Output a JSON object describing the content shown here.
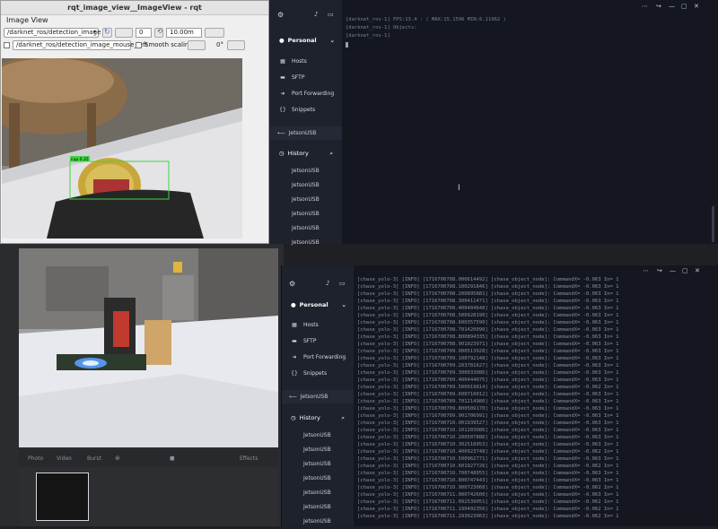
{
  "rqt": {
    "window_title": "rqt_image_view__ImageView - rqt",
    "dock_title": "Image View",
    "topic": "/darknet_ros/detection_image",
    "scale_value": "0",
    "fps_value": "10.00m",
    "mouse_topic": "/darknet_ros/detection_image_mouse_left",
    "smooth_scaling_label": "Smooth scaling",
    "rotation_value": "0°",
    "detection_label": "cup 0.35"
  },
  "term1": {
    "sidebar": {
      "personal_label": "Personal",
      "items": [
        {
          "icon": "hosts-icon",
          "label": "Hosts"
        },
        {
          "icon": "sftp-icon",
          "label": "SFTP"
        },
        {
          "icon": "port-forwarding-icon",
          "label": "Port Forwarding"
        },
        {
          "icon": "snippets-icon",
          "label": "Snippets"
        }
      ],
      "active_host": "JetsonUSB",
      "history_label": "History",
      "history": [
        "JetsonUSB",
        "JetsonUSB",
        "JetsonUSB",
        "JetsonUSB",
        "JetsonUSB",
        "JetsonUSB"
      ]
    },
    "lines": [
      "[darknet_ros-1] FPS:13.4 : ( MAX:15.1596 MIN:6.11962 )",
      "[darknet_ros-1] Objects:",
      "[darknet_ros-1]"
    ]
  },
  "camera": {
    "modes": [
      "Photo",
      "Video",
      "Burst"
    ],
    "effects_label": "Effects"
  },
  "term2": {
    "sidebar": {
      "personal_label": "Personal",
      "items": [
        {
          "icon": "hosts-icon",
          "label": "Hosts"
        },
        {
          "icon": "sftp-icon",
          "label": "SFTP"
        },
        {
          "icon": "port-forwarding-icon",
          "label": "Port Forwarding"
        },
        {
          "icon": "snippets-icon",
          "label": "Snippets"
        }
      ],
      "active_host": "JetsonUSB",
      "history_label": "History",
      "history": [
        "JetsonUSB",
        "JetsonUSB",
        "JetsonUSB",
        "JetsonUSB",
        "JetsonUSB",
        "JetsonUSB",
        "JetsonUSB",
        "JetsonUSB"
      ]
    },
    "log_lines": [
      "[chase_yolo-3] [INFO] [1716700708.000614492] [chase_object_node]: CommandX= -0.063 In= 1",
      "[chase_yolo-3] [INFO] [1716700708.100291846] [chase_object_node]: CommandX= -0.063 In= 1",
      "[chase_yolo-3] [INFO] [1716700708.200895881] [chase_object_node]: CommandX= -0.063 In= 1",
      "[chase_yolo-3] [INFO] [1716700708.300411471] [chase_object_node]: CommandX= -0.063 In= 1",
      "[chase_yolo-3] [INFO] [1716700708.400404648] [chase_object_node]: CommandX= -0.063 In= 1",
      "[chase_yolo-3] [INFO] [1716700708.500928190] [chase_object_node]: CommandX= -0.063 In= 1",
      "[chase_yolo-3] [INFO] [1716700708.600357590] [chase_object_node]: CommandX= -0.063 In= 1",
      "[chase_yolo-3] [INFO] [1716700708.701420090] [chase_object_node]: CommandX= -0.063 In= 1",
      "[chase_yolo-3] [INFO] [1716700708.800894335] [chase_object_node]: CommandX= -0.063 In= 1",
      "[chase_yolo-3] [INFO] [1716700708.901023971] [chase_object_node]: CommandX= -0.063 In= 1",
      "[chase_yolo-3] [INFO] [1716700709.000513928] [chase_object_node]: CommandX= -0.063 In= 1",
      "[chase_yolo-3] [INFO] [1716700709.100792148] [chase_object_node]: CommandX= -0.063 In= 1",
      "[chase_yolo-3] [INFO] [1716700709.203781627] [chase_object_node]: CommandX= -0.063 In= 1",
      "[chase_yolo-3] [INFO] [1716700709.300033086] [chase_object_node]: CommandX= -0.063 In= 1",
      "[chase_yolo-3] [INFO] [1716700709.400444075] [chase_object_node]: CommandX= -0.063 In= 1",
      "[chase_yolo-3] [INFO] [1716700709.500919814] [chase_object_node]: CommandX= -0.062 In= 1",
      "[chase_yolo-3] [INFO] [1716700709.600710012] [chase_object_node]: CommandX= -0.063 In= 1",
      "[chase_yolo-3] [INFO] [1716700709.701214980] [chase_object_node]: CommandX= -0.063 In= 1",
      "[chase_yolo-3] [INFO] [1716700709.800509170] [chase_object_node]: CommandX= -0.063 In= 1",
      "[chase_yolo-3] [INFO] [1716700709.901706991] [chase_object_node]: CommandX= -0.063 In= 1",
      "[chase_yolo-3] [INFO] [1716700710.001939527] [chase_object_node]: CommandX= -0.063 In= 1",
      "[chase_yolo-3] [INFO] [1716700710.101203086] [chase_object_node]: CommandX= -0.063 In= 1",
      "[chase_yolo-3] [INFO] [1716700710.200507886] [chase_object_node]: CommandX= -0.063 In= 1",
      "[chase_yolo-3] [INFO] [1716700710.302518953] [chase_object_node]: CommandX= -0.063 In= 1",
      "[chase_yolo-3] [INFO] [1716700710.400923748] [chase_object_node]: CommandX= -0.062 In= 1",
      "[chase_yolo-3] [INFO] [1716700710.500962771] [chase_object_node]: CommandX= -0.063 In= 1",
      "[chase_yolo-3] [INFO] [1716700710.601927726] [chase_object_node]: CommandX= -0.062 In= 1",
      "[chase_yolo-3] [INFO] [1716700710.700748055] [chase_object_node]: CommandX= -0.063 In= 1",
      "[chase_yolo-3] [INFO] [1716700710.800747443] [chase_object_node]: CommandX= -0.063 In= 1",
      "[chase_yolo-3] [INFO] [1716700710.900723068] [chase_object_node]: CommandX= -0.062 In= 1",
      "[chase_yolo-3] [INFO] [1716700711.000742600] [chase_object_node]: CommandX= -0.063 In= 1",
      "[chase_yolo-3] [INFO] [1716700711.092539051] [chase_object_node]: CommandX= -0.062 In= 1",
      "[chase_yolo-3] [INFO] [1716700711.190492356] [chase_object_node]: CommandX= -0.062 In= 1",
      "[chase_yolo-3] [INFO] [1716700711.293023063] [chase_object_node]: CommandX= -0.062 In= 1"
    ]
  }
}
